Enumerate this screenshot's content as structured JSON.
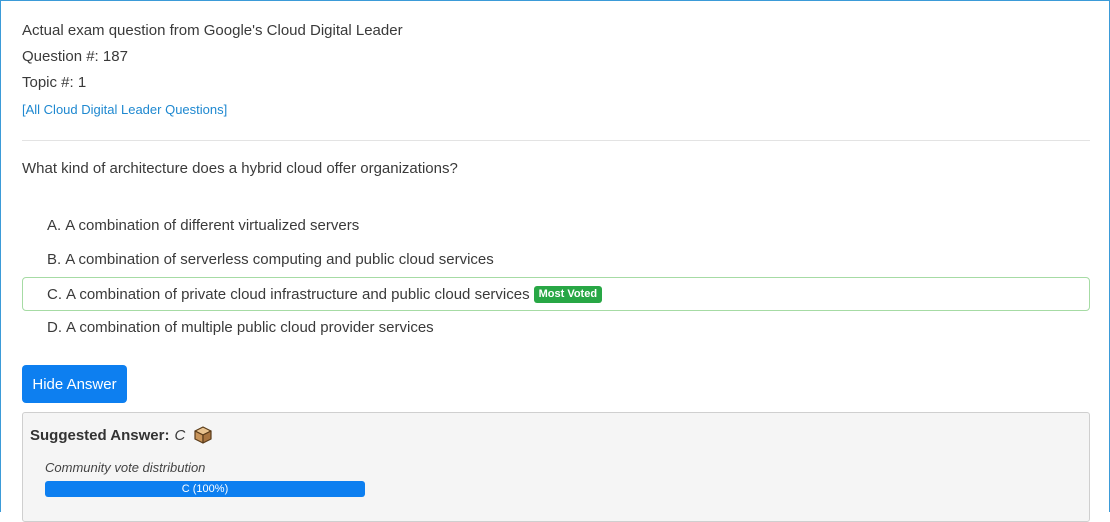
{
  "header": {
    "exam_line": "Actual exam question from Google's Cloud Digital Leader",
    "question_number": "Question #: 187",
    "topic": "Topic #: 1",
    "all_questions_link": "[All Cloud Digital Leader Questions]"
  },
  "question": {
    "text": "What kind of architecture does a hybrid cloud offer organizations?"
  },
  "choices": [
    {
      "letter": "A.",
      "text": "A combination of different virtualized servers"
    },
    {
      "letter": "B.",
      "text": "A combination of serverless computing and public cloud services"
    },
    {
      "letter": "C.",
      "text": "A combination of private cloud infrastructure and public cloud services",
      "badge": "Most Voted",
      "correct": true
    },
    {
      "letter": "D.",
      "text": "A combination of multiple public cloud provider services"
    }
  ],
  "controls": {
    "hide_answer_label": "Hide Answer"
  },
  "answer": {
    "suggested_label": "Suggested Answer:",
    "suggested_value": "C",
    "icon": "answer-box-icon",
    "vote_title": "Community vote distribution",
    "vote_label": "C (100%)",
    "vote_fraction": 1.0
  },
  "colors": {
    "primary": "#0d7ff0",
    "badge_green": "#28a745",
    "link": "#1e88d0",
    "correct_border": "#a6dba4"
  }
}
